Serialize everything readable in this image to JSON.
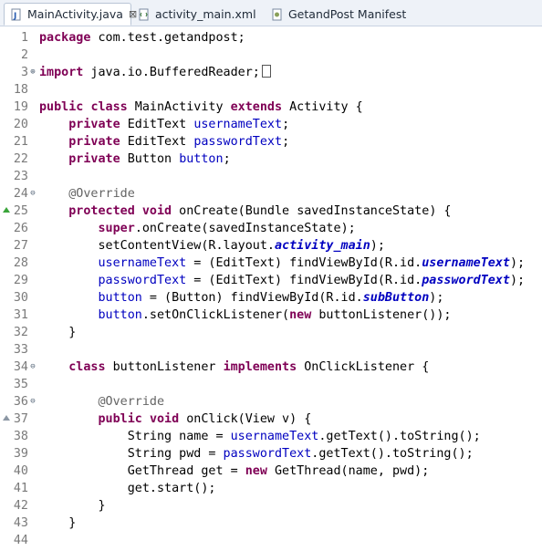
{
  "tabs": [
    {
      "label": "MainActivity.java",
      "active": true,
      "icon": "java-file-icon",
      "closable": true
    },
    {
      "label": "activity_main.xml",
      "active": false,
      "icon": "xml-file-icon",
      "closable": false
    },
    {
      "label": "GetandPost Manifest",
      "active": false,
      "icon": "manifest-file-icon",
      "closable": false
    }
  ],
  "tab_close_symbol": "⊠",
  "lines": [
    {
      "n": "1",
      "tokens": [
        [
          "kw",
          "package"
        ],
        [
          "t",
          " com.test.getandpost;"
        ]
      ]
    },
    {
      "n": "2",
      "tokens": []
    },
    {
      "n": "3",
      "marker": "⊕",
      "tokens": [
        [
          "kw",
          "import"
        ],
        [
          "t",
          " java.io.BufferedReader;"
        ],
        [
          "box",
          ""
        ]
      ]
    },
    {
      "n": "18",
      "tokens": []
    },
    {
      "n": "19",
      "tokens": [
        [
          "kw",
          "public"
        ],
        [
          "t",
          " "
        ],
        [
          "kw",
          "class"
        ],
        [
          "t",
          " MainActivity "
        ],
        [
          "kw",
          "extends"
        ],
        [
          "t",
          " Activity {"
        ]
      ]
    },
    {
      "n": "20",
      "tokens": [
        [
          "t",
          "    "
        ],
        [
          "kw",
          "private"
        ],
        [
          "t",
          " EditText "
        ],
        [
          "fld",
          "usernameText"
        ],
        [
          "t",
          ";"
        ]
      ]
    },
    {
      "n": "21",
      "tokens": [
        [
          "t",
          "    "
        ],
        [
          "kw",
          "private"
        ],
        [
          "t",
          " EditText "
        ],
        [
          "fld",
          "passwordText"
        ],
        [
          "t",
          ";"
        ]
      ]
    },
    {
      "n": "22",
      "tokens": [
        [
          "t",
          "    "
        ],
        [
          "kw",
          "private"
        ],
        [
          "t",
          " Button "
        ],
        [
          "fld",
          "button"
        ],
        [
          "t",
          ";"
        ]
      ]
    },
    {
      "n": "23",
      "tokens": []
    },
    {
      "n": "24",
      "marker": "⊖",
      "tokens": [
        [
          "t",
          "    "
        ],
        [
          "ann",
          "@Override"
        ]
      ]
    },
    {
      "n": "25",
      "override": "green",
      "tokens": [
        [
          "t",
          "    "
        ],
        [
          "kw",
          "protected"
        ],
        [
          "t",
          " "
        ],
        [
          "kw",
          "void"
        ],
        [
          "t",
          " onCreate(Bundle "
        ],
        [
          "t",
          "savedInstanceState"
        ],
        [
          "t",
          ") {"
        ]
      ]
    },
    {
      "n": "26",
      "tokens": [
        [
          "t",
          "        "
        ],
        [
          "kw",
          "super"
        ],
        [
          "t",
          ".onCreate("
        ],
        [
          "t",
          "savedInstanceState"
        ],
        [
          "t",
          ");"
        ]
      ]
    },
    {
      "n": "27",
      "tokens": [
        [
          "t",
          "        setContentView(R.layout."
        ],
        [
          "sfld",
          "activity_main"
        ],
        [
          "t",
          ");"
        ]
      ]
    },
    {
      "n": "28",
      "tokens": [
        [
          "t",
          "        "
        ],
        [
          "fld",
          "usernameText"
        ],
        [
          "t",
          " = (EditText) findViewById(R.id."
        ],
        [
          "sfld",
          "usernameText"
        ],
        [
          "t",
          ");"
        ]
      ]
    },
    {
      "n": "29",
      "tokens": [
        [
          "t",
          "        "
        ],
        [
          "fld",
          "passwordText"
        ],
        [
          "t",
          " = (EditText) findViewById(R.id."
        ],
        [
          "sfld",
          "passwordText"
        ],
        [
          "t",
          ");"
        ]
      ]
    },
    {
      "n": "30",
      "tokens": [
        [
          "t",
          "        "
        ],
        [
          "fld",
          "button"
        ],
        [
          "t",
          " = (Button) findViewById(R.id."
        ],
        [
          "sfld",
          "subButton"
        ],
        [
          "t",
          ");"
        ]
      ]
    },
    {
      "n": "31",
      "tokens": [
        [
          "t",
          "        "
        ],
        [
          "fld",
          "button"
        ],
        [
          "t",
          ".setOnClickListener("
        ],
        [
          "kw",
          "new"
        ],
        [
          "t",
          " buttonListener());"
        ]
      ]
    },
    {
      "n": "32",
      "tokens": [
        [
          "t",
          "    }"
        ]
      ]
    },
    {
      "n": "33",
      "tokens": []
    },
    {
      "n": "34",
      "marker": "⊖",
      "tokens": [
        [
          "t",
          "    "
        ],
        [
          "kw",
          "class"
        ],
        [
          "t",
          " buttonListener "
        ],
        [
          "kw",
          "implements"
        ],
        [
          "t",
          " OnClickListener {"
        ]
      ]
    },
    {
      "n": "35",
      "tokens": []
    },
    {
      "n": "36",
      "marker": "⊖",
      "tokens": [
        [
          "t",
          "        "
        ],
        [
          "ann",
          "@Override"
        ]
      ]
    },
    {
      "n": "37",
      "override": "outline",
      "tokens": [
        [
          "t",
          "        "
        ],
        [
          "kw",
          "public"
        ],
        [
          "t",
          " "
        ],
        [
          "kw",
          "void"
        ],
        [
          "t",
          " onClick(View v) {"
        ]
      ]
    },
    {
      "n": "38",
      "tokens": [
        [
          "t",
          "            String name = "
        ],
        [
          "fld",
          "usernameText"
        ],
        [
          "t",
          ".getText().toString();"
        ]
      ]
    },
    {
      "n": "39",
      "tokens": [
        [
          "t",
          "            String pwd = "
        ],
        [
          "fld",
          "passwordText"
        ],
        [
          "t",
          ".getText().toString();"
        ]
      ]
    },
    {
      "n": "40",
      "tokens": [
        [
          "t",
          "            GetThread get = "
        ],
        [
          "kw",
          "new"
        ],
        [
          "t",
          " GetThread(name, pwd);"
        ]
      ]
    },
    {
      "n": "41",
      "tokens": [
        [
          "t",
          "            get.start();"
        ]
      ]
    },
    {
      "n": "42",
      "tokens": [
        [
          "t",
          "        }"
        ]
      ]
    },
    {
      "n": "43",
      "tokens": [
        [
          "t",
          "    }"
        ]
      ]
    },
    {
      "n": "44",
      "tokens": []
    }
  ],
  "colors": {
    "keyword": "#7f0055",
    "field": "#0000c0",
    "annotation": "#646464",
    "line_number": "#7a7a7a"
  }
}
